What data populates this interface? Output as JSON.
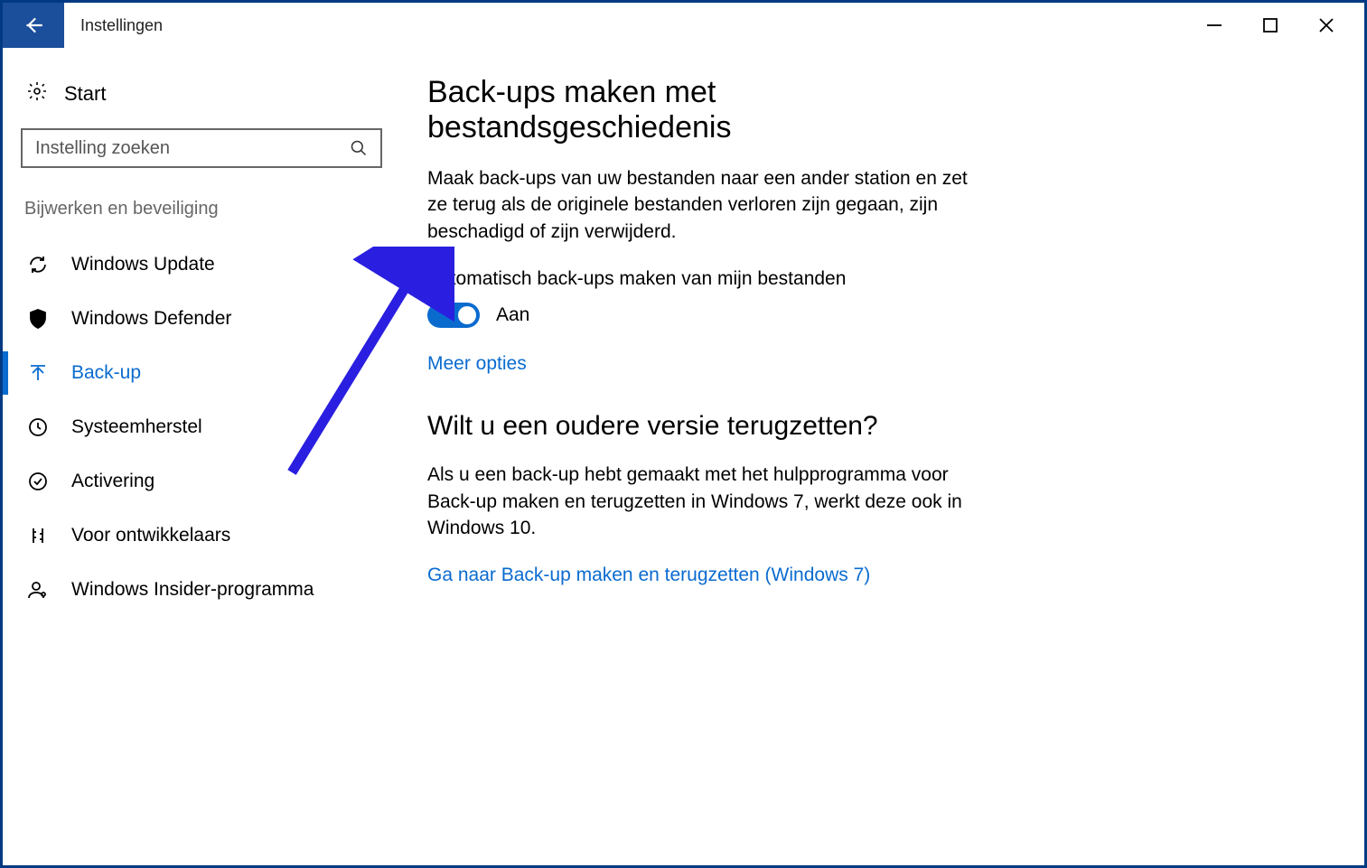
{
  "window": {
    "title": "Instellingen"
  },
  "sidebar": {
    "start_label": "Start",
    "search_placeholder": "Instelling zoeken",
    "category": "Bijwerken en beveiliging",
    "items": [
      {
        "label": "Windows Update"
      },
      {
        "label": "Windows Defender"
      },
      {
        "label": "Back-up"
      },
      {
        "label": "Systeemherstel"
      },
      {
        "label": "Activering"
      },
      {
        "label": "Voor ontwikkelaars"
      },
      {
        "label": "Windows Insider-programma"
      }
    ]
  },
  "main": {
    "heading1": "Back-ups maken met bestandsgeschiedenis",
    "para1": "Maak back-ups van uw bestanden naar een ander station en zet ze terug als de originele bestanden verloren zijn gegaan, zijn beschadigd of zijn verwijderd.",
    "toggle_label": "Automatisch back-ups maken van mijn bestanden",
    "toggle_state": "Aan",
    "link1": "Meer opties",
    "heading2": "Wilt u een oudere versie terugzetten?",
    "para2": "Als u een back-up hebt gemaakt met het hulpprogramma voor Back-up maken en terugzetten in Windows 7, werkt deze ook in Windows 10.",
    "link2": "Ga naar Back-up maken en terugzetten (Windows 7)"
  },
  "colors": {
    "accent": "#0a6bcf",
    "arrow": "#2a1fe0"
  }
}
